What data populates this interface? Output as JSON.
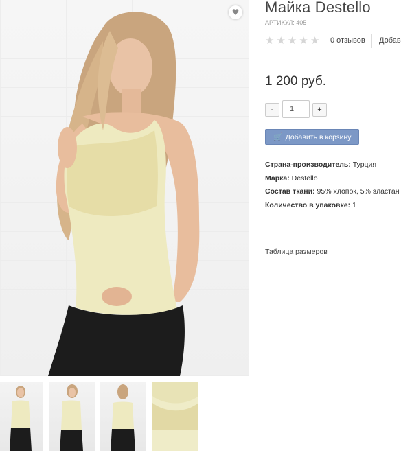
{
  "product": {
    "title": "Майка Destello",
    "sku": "АРТИКУЛ: 405",
    "rating": {
      "value": 0,
      "max": 5
    },
    "reviews_label": "0 отзывов",
    "add_review_label": "Добав",
    "price": "1 200 руб.",
    "quantity": {
      "value": "1",
      "minus_label": "-",
      "plus_label": "+"
    },
    "add_to_cart_label": "Добавить в корзину",
    "properties": [
      {
        "name": "Страна-производитель:",
        "value": "Турция"
      },
      {
        "name": "Марка:",
        "value": "Destello"
      },
      {
        "name": "Состав ткани:",
        "value": "95% хлопок, 5% эластан"
      },
      {
        "name": "Количество в упаковке:",
        "value": "1"
      }
    ],
    "size_table_label": "Таблица размеров"
  },
  "gallery": {
    "thumbnails": [
      "front-view",
      "side-view",
      "back-view",
      "fabric-closeup"
    ]
  },
  "icons": {
    "wishlist": "heart-icon",
    "cart": "cart-icon",
    "star": "star-icon"
  },
  "colors": {
    "top_fabric": "#eeeac0",
    "button": "#7c98c6",
    "star_empty": "#d6d6d6",
    "jeans": "#1c1c1c",
    "hair": "#c9a57e"
  }
}
